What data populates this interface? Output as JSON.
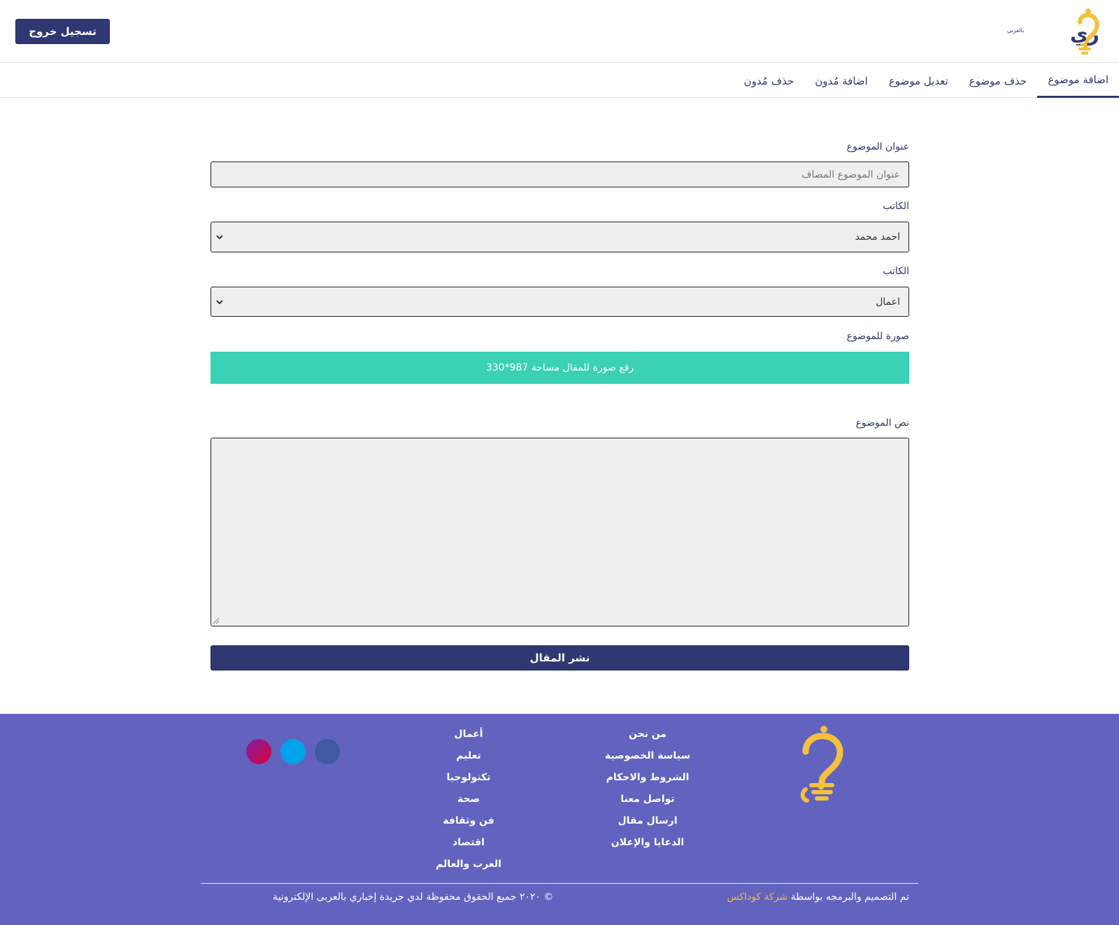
{
  "header": {
    "logo_text": "إخباري",
    "logo_subtext": "بالعربي",
    "logout_label": "تسجيل خروج"
  },
  "tabs": [
    {
      "label": "اضافة موضوع",
      "active": true
    },
    {
      "label": "حذف موضوع",
      "active": false
    },
    {
      "label": "تعديل موضوع",
      "active": false
    },
    {
      "label": "اضافة مُدون",
      "active": false
    },
    {
      "label": "حذف مُدون",
      "active": false
    }
  ],
  "form": {
    "title_label": "عنوان الموضوع",
    "title_placeholder": "عنوان الموضوع المضاف",
    "author_label": "الكاتب",
    "author_value": "احمد محمد",
    "category_label": "الكاتب",
    "category_value": "اعمال",
    "image_label": "صورة للموضوع",
    "upload_label": "رفع صورة للمقال مساحة 987*330",
    "body_label": "نص الموضوع",
    "publish_label": "نشر المقال"
  },
  "footer": {
    "about_links": [
      "من نحن",
      "سياسة الخصوصية",
      "الشروط والاحكام",
      "تواصل معنا",
      "ارسال مقال",
      "الدعايا والإعلان"
    ],
    "category_links": [
      "أعمال",
      "تعليم",
      "تكنولوجيا",
      "صحة",
      "فن وثقافة",
      "اقتصاد",
      "العرب والعالم"
    ],
    "social": [
      "facebook-icon",
      "twitter-icon",
      "instagram-icon"
    ],
    "credits_text": "تم التصميم والبرمجه بواسطة",
    "credits_company": "شركة كوداكس",
    "copyright": "© ٢٠٢٠ جميع الحقوق محفوظة لدي جريدة إخباري بالعربى الإلكترونية"
  },
  "colors": {
    "primary": "#2f3872",
    "accent": "#3ad1b5",
    "footer_bg": "#6263bf",
    "logo_yellow": "#f5c13c",
    "company_link": "#f5b845"
  }
}
